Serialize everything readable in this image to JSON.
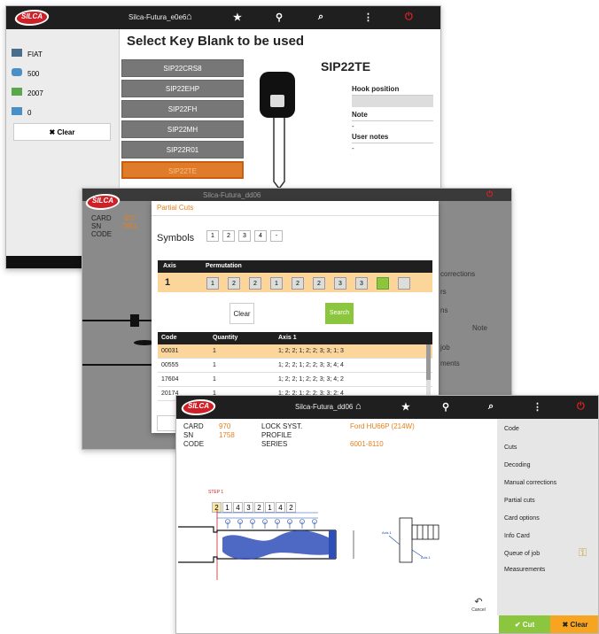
{
  "win1": {
    "logo": "SILCA",
    "device_name": "Silca-Futura_e0e6",
    "title": "Select Key Blank to be used",
    "filters": [
      {
        "icon": "car-brand-icon",
        "label": "FIAT"
      },
      {
        "icon": "car-model-icon",
        "label": "500"
      },
      {
        "icon": "calendar-icon",
        "label": "2007"
      },
      {
        "icon": "calendar-icon",
        "label": "0"
      }
    ],
    "clear_label": "✖ Clear",
    "key_list": [
      "SIP22CRS8",
      "SIP22EHP",
      "SIP22FH",
      "SIP22MH",
      "SIP22R01",
      "SIP22TE"
    ],
    "selected_key": "SIP22TE",
    "detail_title": "SIP22TE",
    "hook_label": "Hook position",
    "note_label": "Note",
    "note_value": "-",
    "user_notes_label": "User notes",
    "user_notes_value": "-"
  },
  "win2": {
    "logo": "SILCA",
    "device_name": "Silca-Futura_dd06",
    "card_label": "CARD",
    "card_value": "607",
    "sn_label": "SN",
    "sn_value": "7851",
    "code_label": "CODE",
    "dialog_title": "Partial Cuts",
    "symbols_label": "Symbols",
    "symbols": [
      "1",
      "2",
      "3",
      "4",
      "-"
    ],
    "axis_header": "Axis",
    "perm_header": "Permutation",
    "axis_value": "1",
    "permutation": [
      "1",
      "2",
      "2",
      "1",
      "2",
      "2",
      "3",
      "3",
      "",
      ""
    ],
    "clear_label": "Clear",
    "search_label": "Search",
    "table_headers": [
      "Code",
      "Quantity",
      "Axis 1"
    ],
    "rows": [
      [
        "00031",
        "1",
        "1; 2; 2; 1; 2; 2; 3; 3; 1; 3"
      ],
      [
        "00555",
        "1",
        "1; 2; 2; 1; 2; 2; 3; 3; 4; 4"
      ],
      [
        "17604",
        "1",
        "1; 2; 2; 1; 2; 2; 3; 3; 4; 2"
      ],
      [
        "20174",
        "1",
        "1; 2; 2; 1; 2; 2; 3; 3; 2; 4"
      ]
    ],
    "bg_menu": [
      "corrections",
      "rs",
      "ns",
      "Note",
      "job",
      "ments"
    ]
  },
  "win3": {
    "logo": "SILCA",
    "device_name": "Silca-Futura_dd06",
    "card_label": "CARD",
    "card_value": "970",
    "sn_label": "SN",
    "sn_value": "1758",
    "code_label": "CODE",
    "lock_label": "LOCK SYST.",
    "lock_value": "Ford HU66P (214W)",
    "profile_label": "PROFILE",
    "series_label": "SERIES",
    "series_value": "6001-8110",
    "step_label": "STEP 1",
    "cuts": [
      "2",
      "1",
      "4",
      "3",
      "2",
      "1",
      "4",
      "2"
    ],
    "axis_label_a": "Axis 1",
    "axis_label_b": "Axis 1",
    "menu": [
      "Code",
      "Cuts",
      "Decoding",
      "Manual corrections",
      "Partial cuts",
      "Card options",
      "Info Card",
      "Queue of job",
      "Measurements"
    ],
    "cancel_label": "Cancel",
    "cut_label": "✔ Cut",
    "clear_label": "✖ Clear"
  },
  "colors": {
    "accent": "#e5801c",
    "green": "#8cc63f",
    "red": "#d01f26",
    "topbar": "#1f1f1f"
  }
}
